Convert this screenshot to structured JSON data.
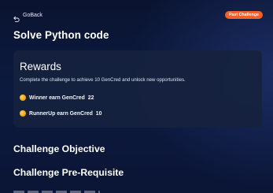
{
  "header": {
    "back_label": "GoBack",
    "back_icon": "undo-arrow-icon",
    "badge_label": "Past Challenge",
    "badge_color": "#f0602a"
  },
  "page": {
    "title": "Solve Python code"
  },
  "rewards": {
    "title": "Rewards",
    "description": "Complete the challenge to achieve 10 GenCred and unlock new opportunities.",
    "items": [
      {
        "icon": "coin-icon",
        "label": "Winner earn GenCred",
        "value": "22"
      },
      {
        "icon": "coin-icon",
        "label": "RunnerUp earn GenCred",
        "value": "10"
      }
    ],
    "coin_color": "#f5a70f"
  },
  "sections": [
    {
      "heading": "Challenge Objective"
    },
    {
      "heading": "Challenge Pre-Requisite"
    }
  ],
  "colors": {
    "background": "#0b1838",
    "card": "#16223e",
    "accent": "#f0602a"
  }
}
